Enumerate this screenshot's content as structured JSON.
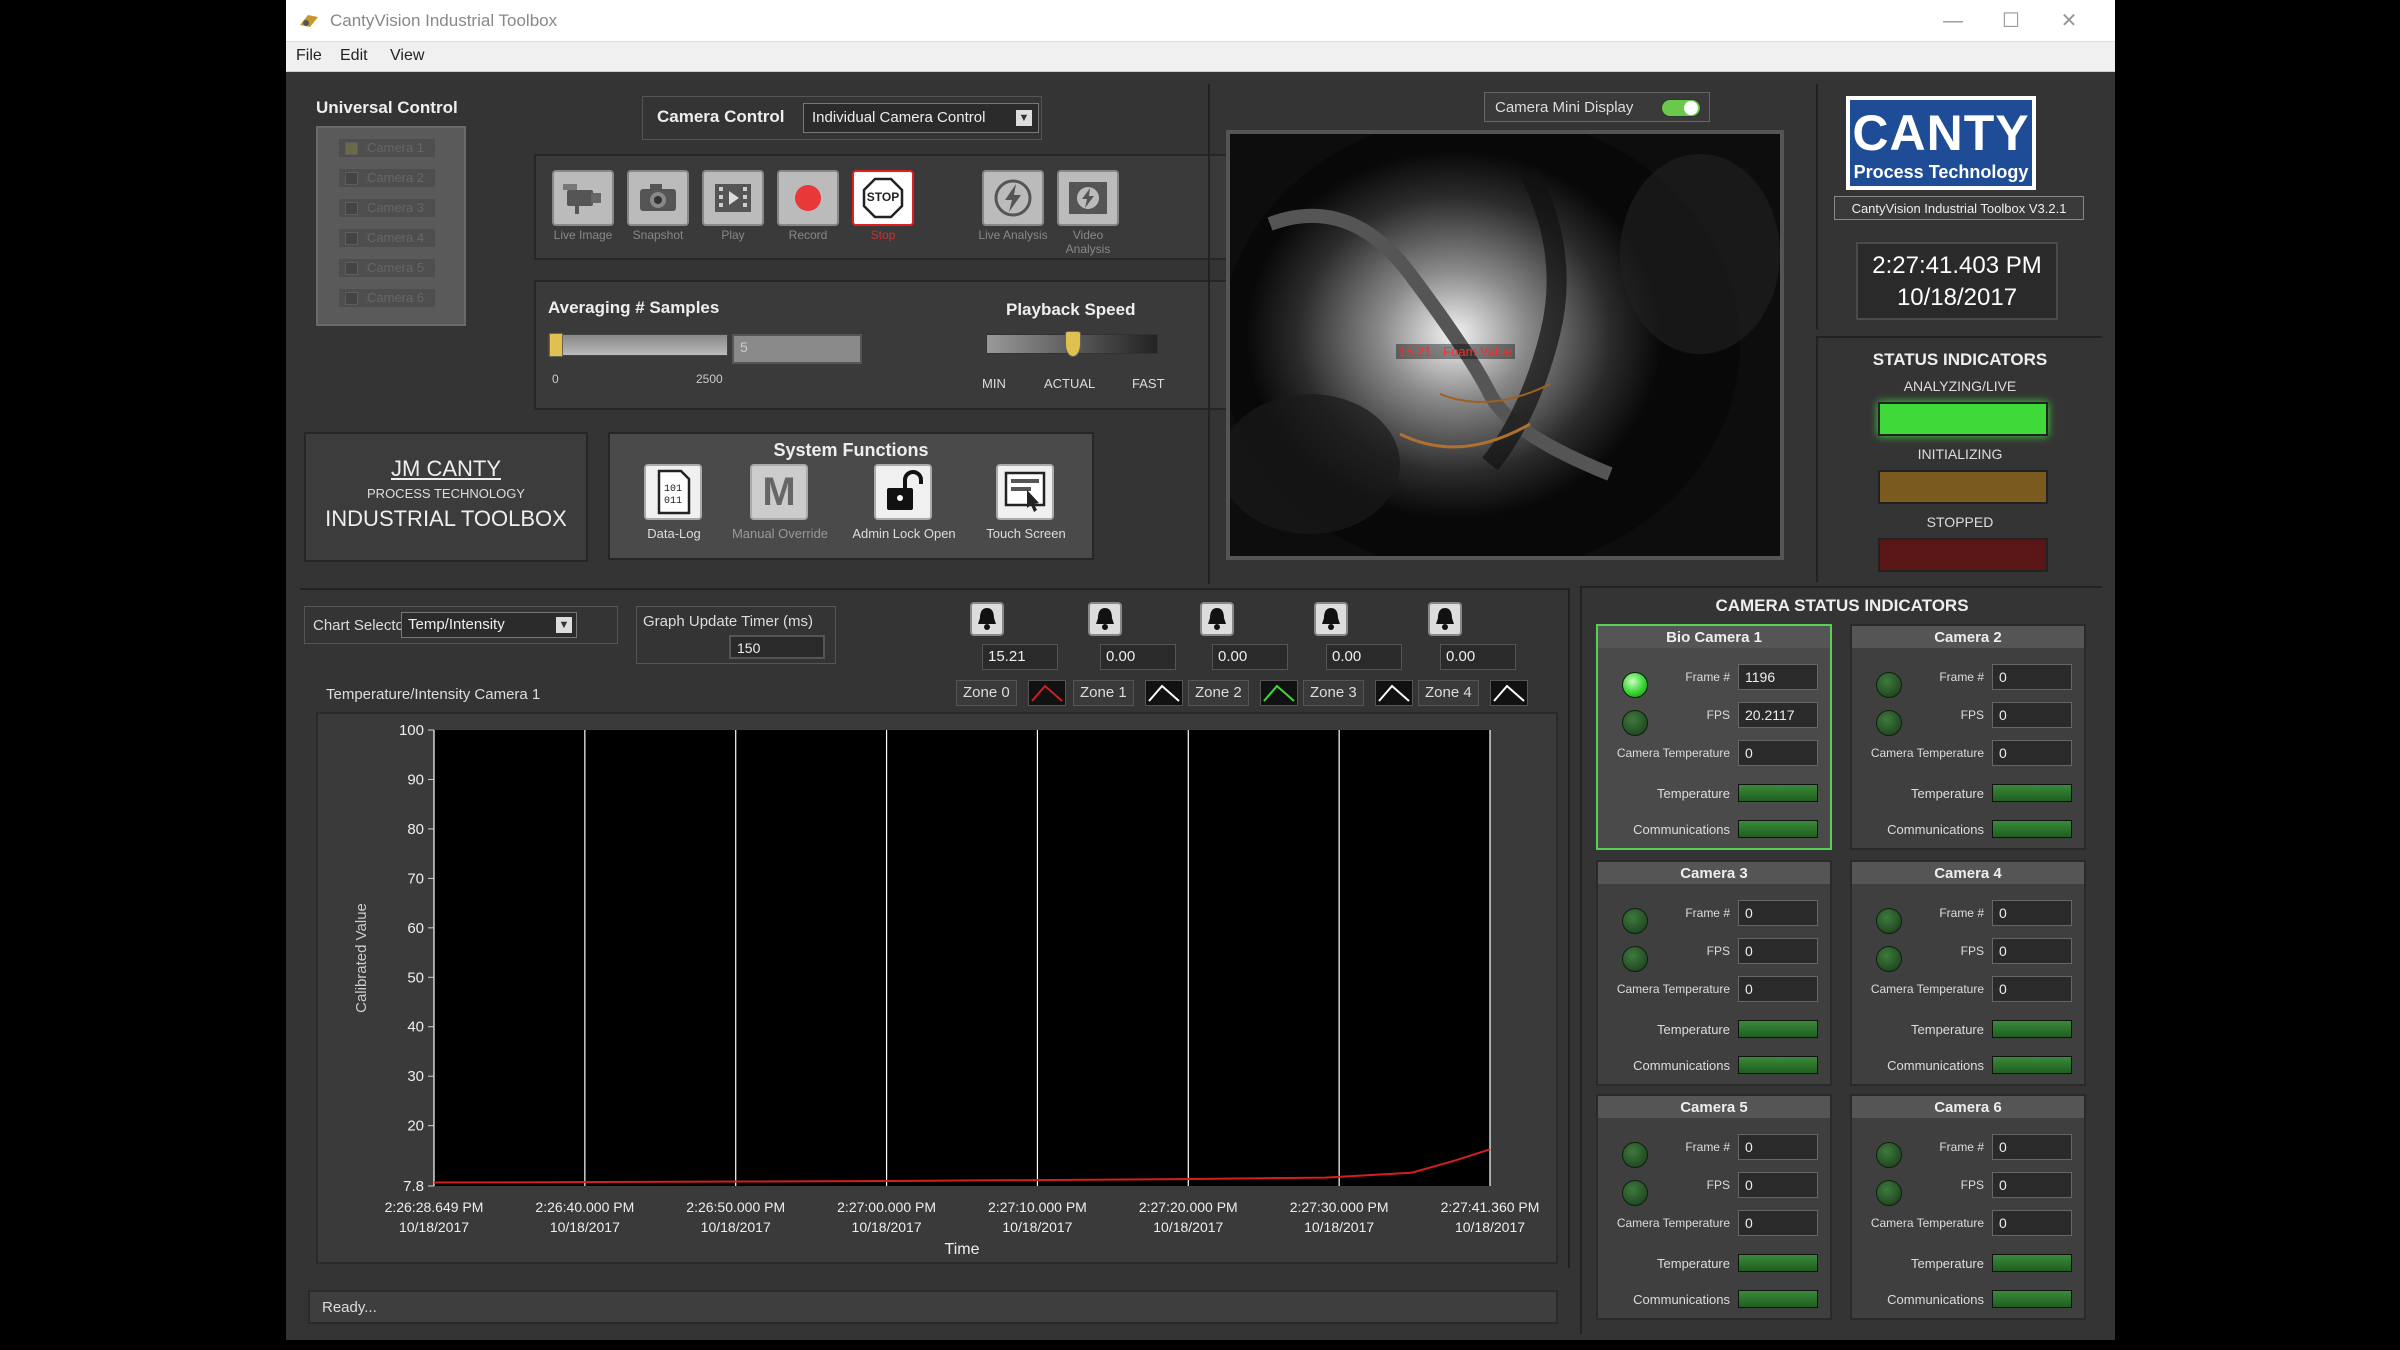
{
  "window": {
    "title": "CantyVision Industrial Toolbox",
    "menu": [
      "File",
      "Edit",
      "View"
    ],
    "controls": {
      "minimize": "—",
      "maximize": "☐",
      "close": "✕"
    }
  },
  "universal_control": {
    "title": "Universal Control",
    "cameras": [
      "Camera 1",
      "Camera 2",
      "Camera 3",
      "Camera 4",
      "Camera 5",
      "Camera 6"
    ]
  },
  "camera_control": {
    "label": "Camera Control",
    "mode": "Individual Camera Control",
    "buttons": [
      {
        "label": "Live Image",
        "icon": "camera-icon"
      },
      {
        "label": "Snapshot",
        "icon": "snapshot-icon"
      },
      {
        "label": "Play",
        "icon": "play-icon"
      },
      {
        "label": "Record",
        "icon": "record-icon"
      },
      {
        "label": "Stop",
        "icon": "stop-icon",
        "face_text": "STOP"
      },
      {
        "label": "Live Analysis",
        "icon": "lightning-icon"
      },
      {
        "label": "Video Analysis",
        "icon": "video-analysis-icon"
      }
    ]
  },
  "averaging": {
    "title": "Averaging # Samples",
    "value": "5",
    "min": "0",
    "max": "2500",
    "level": 0.002
  },
  "playback": {
    "title": "Playback Speed",
    "labels": [
      "MIN",
      "ACTUAL",
      "FAST"
    ],
    "level": 0.5
  },
  "brand_block": {
    "line1": "JM CANTY",
    "line2": "PROCESS TECHNOLOGY",
    "line3": "INDUSTRIAL TOOLBOX"
  },
  "system_functions": {
    "title": "System Functions",
    "buttons": [
      {
        "label": "Data-Log",
        "icon": "data-log-icon",
        "face_text": "101\n011"
      },
      {
        "label": "Manual Override",
        "icon": "manual-override-icon",
        "face_text": "M"
      },
      {
        "label": "Admin Lock Open",
        "icon": "unlock-icon"
      },
      {
        "label": "Touch Screen",
        "icon": "touch-screen-icon"
      }
    ]
  },
  "mini_display": {
    "label": "Camera Mini Display",
    "on": true,
    "overlay_value": "15.21",
    "overlay_label": "Foam Value"
  },
  "logo": {
    "brand": "CANTY",
    "tagline": "Process Technology",
    "version": "CantyVision Industrial Toolbox V3.2.1"
  },
  "clock": {
    "time": "2:27:41.403 PM",
    "date": "10/18/2017"
  },
  "status_indicators": {
    "title": "STATUS INDICATORS",
    "items": [
      {
        "label": "ANALYZING/LIVE",
        "color": "#3fd93a"
      },
      {
        "label": "INITIALIZING",
        "color": "#7a5a1e"
      },
      {
        "label": "STOPPED",
        "color": "#5a1616"
      }
    ]
  },
  "chart_controls": {
    "selector_label": "Chart Selector",
    "selector_value": "Temp/Intensity",
    "timer_label": "Graph Update Timer (ms)",
    "timer_value": "150"
  },
  "zones": {
    "values": [
      "15.21",
      "0.00",
      "0.00",
      "0.00",
      "0.00"
    ],
    "labels": [
      "Zone 0",
      "Zone 1",
      "Zone 2",
      "Zone 3",
      "Zone 4"
    ],
    "colors": [
      "#d02020",
      "#ffffff",
      "#3fd93a",
      "#ffffff",
      "#ffffff"
    ]
  },
  "chart_data": {
    "type": "line",
    "title": "Temperature/Intensity Camera 1",
    "ylabel": "Calibrated Value",
    "xlabel": "Time",
    "ylim": [
      7.8,
      100
    ],
    "yticks": [
      "100",
      "90",
      "80",
      "70",
      "60",
      "50",
      "40",
      "30",
      "20",
      "7.8"
    ],
    "ytick_values": [
      100,
      90,
      80,
      70,
      60,
      50,
      40,
      30,
      20,
      7.8
    ],
    "xticks": [
      [
        "2:26:28.649 PM",
        "10/18/2017"
      ],
      [
        "2:26:40.000 PM",
        "10/18/2017"
      ],
      [
        "2:26:50.000 PM",
        "10/18/2017"
      ],
      [
        "2:27:00.000 PM",
        "10/18/2017"
      ],
      [
        "2:27:10.000 PM",
        "10/18/2017"
      ],
      [
        "2:27:20.000 PM",
        "10/18/2017"
      ],
      [
        "2:27:30.000 PM",
        "10/18/2017"
      ],
      [
        "2:27:41.360 PM",
        "10/18/2017"
      ]
    ],
    "grid": true,
    "series": [
      {
        "name": "Zone 0",
        "color": "#d02020",
        "x": [
          "2:26:28.649 PM",
          "2:26:40 PM",
          "2:26:50 PM",
          "2:27:00 PM",
          "2:27:10 PM",
          "2:27:20 PM",
          "2:27:30 PM",
          "2:27:36 PM",
          "2:27:39 PM",
          "2:27:41.360 PM"
        ],
        "values": [
          8.5,
          8.6,
          8.7,
          8.8,
          9.0,
          9.2,
          9.5,
          10.5,
          13.0,
          15.21
        ]
      }
    ]
  },
  "camera_status": {
    "title": "CAMERA STATUS INDICATORS",
    "field_labels": [
      "Frame #",
      "FPS",
      "Camera Temperature",
      "Temperature",
      "Communications"
    ],
    "cameras": [
      {
        "name": "Bio Camera 1",
        "frame": "1196",
        "fps": "20.2117",
        "temp": "0",
        "active": true
      },
      {
        "name": "Camera 2",
        "frame": "0",
        "fps": "0",
        "temp": "0",
        "active": false
      },
      {
        "name": "Camera 3",
        "frame": "0",
        "fps": "0",
        "temp": "0",
        "active": false
      },
      {
        "name": "Camera 4",
        "frame": "0",
        "fps": "0",
        "temp": "0",
        "active": false
      },
      {
        "name": "Camera 5",
        "frame": "0",
        "fps": "0",
        "temp": "0",
        "active": false
      },
      {
        "name": "Camera 6",
        "frame": "0",
        "fps": "0",
        "temp": "0",
        "active": false
      }
    ]
  },
  "status_bar": {
    "text": "Ready..."
  }
}
